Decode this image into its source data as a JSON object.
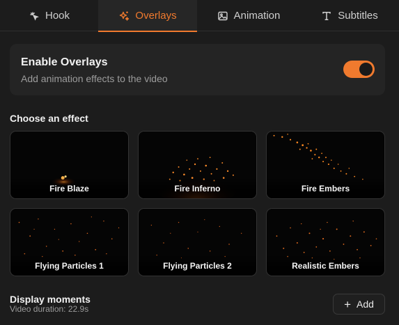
{
  "tabs": [
    {
      "label": "Hook",
      "icon": "sparkle-cursor-icon",
      "active": false
    },
    {
      "label": "Overlays",
      "icon": "sparkles-icon",
      "active": true
    },
    {
      "label": "Animation",
      "icon": "image-icon",
      "active": false
    },
    {
      "label": "Subtitles",
      "icon": "text-icon",
      "active": false
    }
  ],
  "enable": {
    "title": "Enable Overlays",
    "subtitle": "Add animation effects to the video",
    "enabled": true
  },
  "effects": {
    "title": "Choose an effect",
    "items": [
      {
        "label": "Fire Blaze"
      },
      {
        "label": "Fire Inferno"
      },
      {
        "label": "Fire Embers"
      },
      {
        "label": "Flying Particles 1"
      },
      {
        "label": "Flying Particles 2"
      },
      {
        "label": "Realistic Embers"
      }
    ]
  },
  "moments": {
    "title": "Display moments",
    "duration": "Video duration: 22.9s",
    "add_label": "Add"
  },
  "colors": {
    "accent": "#f07a2e",
    "background": "#1c1c1c",
    "card": "#242424"
  }
}
